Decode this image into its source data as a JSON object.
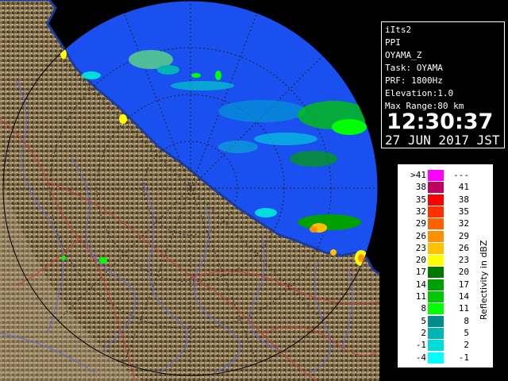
{
  "info": {
    "product": "iIts2",
    "mode": "PPI",
    "field": "OYAMA_Z",
    "task": "Task: OYAMA",
    "prf": "PRF: 1800Hz",
    "elevation": "Elevation:1.0",
    "max_range": "Max Range:80 km",
    "time": "12:30:37",
    "date": "27 JUN 2017 JST"
  },
  "legend": {
    "title": "Reflectivity in dBZ",
    "rows": [
      {
        "low": ">41",
        "high": "---",
        "color": "#ff00ff"
      },
      {
        "low": "38",
        "high": "41",
        "color": "#c0005a"
      },
      {
        "low": "35",
        "high": "38",
        "color": "#ff0000"
      },
      {
        "low": "32",
        "high": "35",
        "color": "#ff3000"
      },
      {
        "low": "29",
        "high": "32",
        "color": "#ff6000"
      },
      {
        "low": "26",
        "high": "29",
        "color": "#ff9000"
      },
      {
        "low": "23",
        "high": "26",
        "color": "#ffc000"
      },
      {
        "low": "20",
        "high": "23",
        "color": "#ffff00"
      },
      {
        "low": "17",
        "high": "20",
        "color": "#007800"
      },
      {
        "low": "14",
        "high": "17",
        "color": "#00a000"
      },
      {
        "low": "11",
        "high": "14",
        "color": "#00c800"
      },
      {
        "low": "8",
        "high": "11",
        "color": "#00ff00"
      },
      {
        "low": "5",
        "high": "8",
        "color": "#008c8c"
      },
      {
        "low": "2",
        "high": "5",
        "color": "#00b4b4"
      },
      {
        "low": "-1",
        "high": "2",
        "color": "#00dcdc"
      },
      {
        "low": "-4",
        "high": "-1",
        "color": "#00ffff"
      }
    ]
  },
  "colors": {
    "sea_echo_free": "#0a3ce6",
    "outer_sea": "#1a50f0",
    "land_dark": "#5a4a30",
    "land_light": "#b8a482",
    "river": "#5a6ae0",
    "boundary": "#c83c3c",
    "range_ring": "#333333"
  }
}
